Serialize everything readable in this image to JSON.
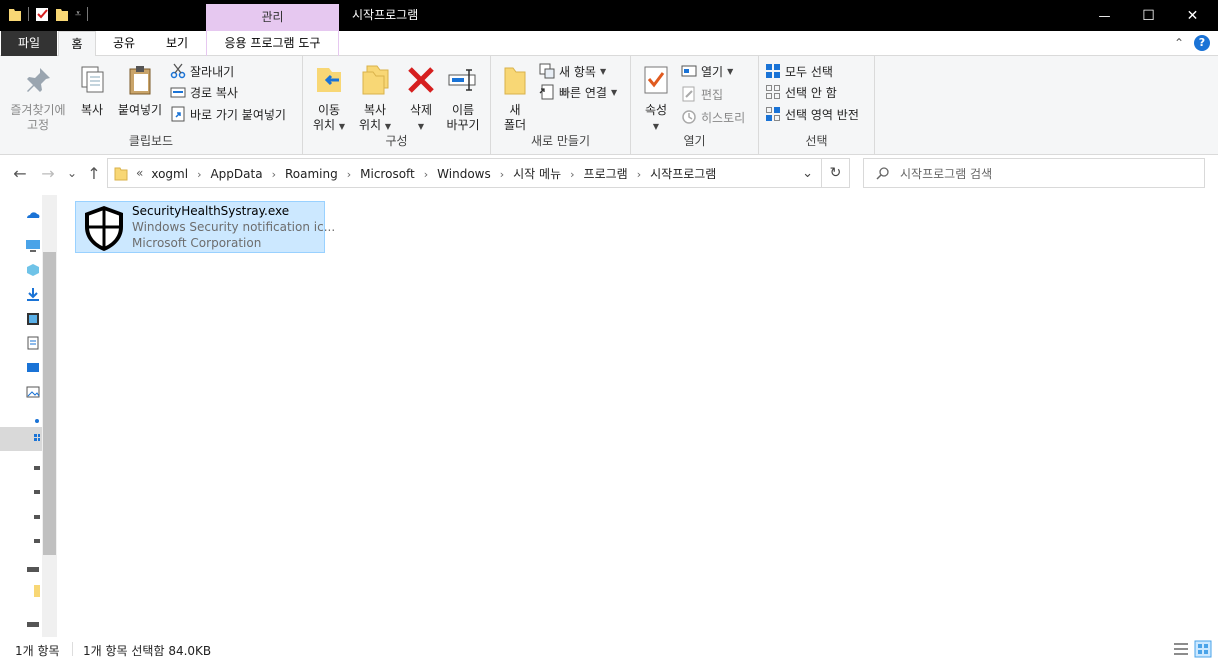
{
  "title_bar": {
    "manage_tab": "관리",
    "title": "시작프로그램",
    "minimize_glyph": "—",
    "maximize_glyph": "☐",
    "close_glyph": "✕"
  },
  "ribbon_tabs": {
    "file": "파일",
    "home": "홈",
    "share": "공유",
    "view": "보기",
    "app_tools": "응용 프로그램 도구",
    "expand_glyph": "⌃",
    "help_glyph": "?"
  },
  "ribbon": {
    "clipboard": {
      "label": "클립보드",
      "pin_line1": "즐겨찾기에",
      "pin_line2": "고정",
      "copy": "복사",
      "paste": "붙여넣기",
      "cut": "잘라내기",
      "copy_path": "경로 복사",
      "paste_shortcut": "바로 가기 붙여넣기"
    },
    "organize": {
      "label": "구성",
      "move_line1": "이동",
      "move_line2": "위치",
      "copy_line1": "복사",
      "copy_line2": "위치",
      "delete": "삭제",
      "rename_line1": "이름",
      "rename_line2": "바꾸기"
    },
    "new": {
      "label": "새로 만들기",
      "new_folder_line1": "새",
      "new_folder_line2": "폴더",
      "new_item": "새 항목",
      "easy_access": "빠른 연결"
    },
    "open": {
      "label": "열기",
      "properties": "속성",
      "open": "열기",
      "edit": "편집",
      "history": "히스토리"
    },
    "select": {
      "label": "선택",
      "select_all": "모두 선택",
      "select_none": "선택 안 함",
      "invert": "선택 영역 반전"
    }
  },
  "address": {
    "back_glyph": "←",
    "forward_glyph": "→",
    "recent_glyph": "⌄",
    "up_glyph": "↑",
    "overflow": "«",
    "crumbs": [
      "xogml",
      "AppData",
      "Roaming",
      "Microsoft",
      "Windows",
      "시작 메뉴",
      "프로그램",
      "시작프로그램"
    ],
    "chevron": "›",
    "dropdown_glyph": "⌄",
    "refresh_glyph": "↻",
    "search_placeholder": "시작프로그램 검색"
  },
  "file_item": {
    "name": "SecurityHealthSystray.exe",
    "description": "Windows Security notification ic...",
    "company": "Microsoft Corporation"
  },
  "status": {
    "count": "1개 항목",
    "selection": "1개 항목 선택함 84.0KB"
  },
  "colors": {
    "selection_bg": "#cce8ff",
    "manage_tab_bg": "#e6c8f0",
    "delete_red": "#d61f1f",
    "folder_yellow": "#f8d775"
  }
}
